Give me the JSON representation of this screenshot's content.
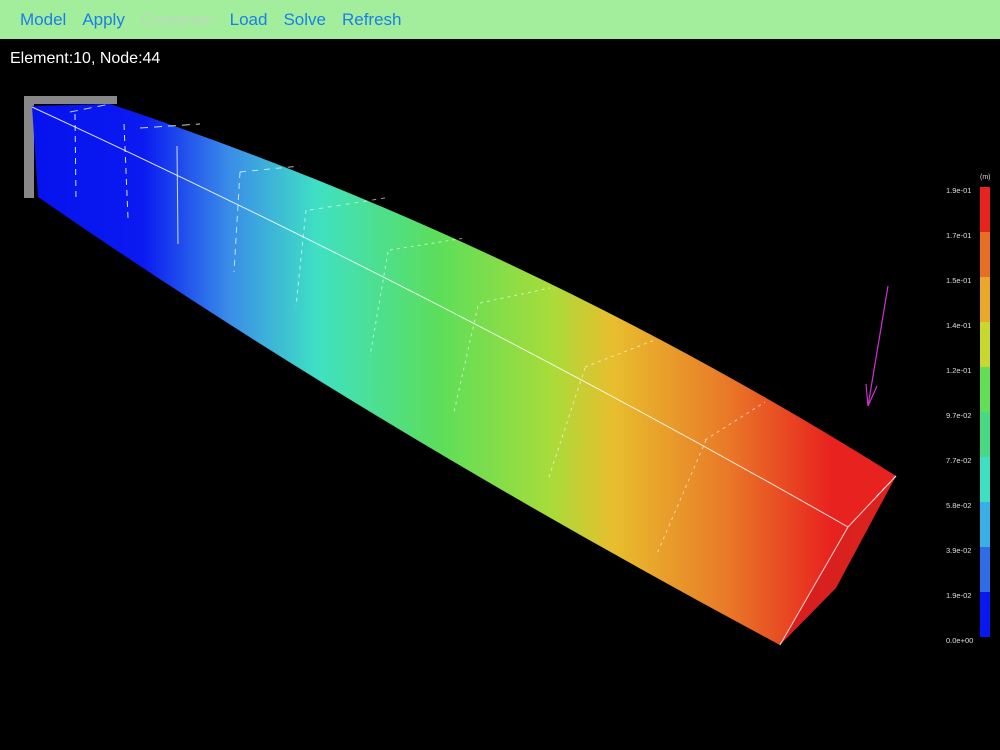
{
  "toolbar": {
    "items": [
      {
        "label": "Model",
        "enabled": true
      },
      {
        "label": "Apply",
        "enabled": true
      },
      {
        "label": "Constrain",
        "enabled": false
      },
      {
        "label": "Load",
        "enabled": true
      },
      {
        "label": "Solve",
        "enabled": true
      },
      {
        "label": "Refresh",
        "enabled": true
      }
    ],
    "colors": {
      "background": "#a3ee9c",
      "enabled": "#1a7fe6",
      "disabled": "#bcd8bd"
    }
  },
  "status": {
    "text": "Element:10, Node:44"
  },
  "legend": {
    "unit": "(m)",
    "ticks": [
      "1.9e-01",
      "1.7e-01",
      "1.5e-01",
      "1.4e-01",
      "1.2e-01",
      "9.7e-02",
      "7.7e-02",
      "5.8e-02",
      "3.9e-02",
      "1.9e-02",
      "0.0e+00"
    ],
    "colors": [
      "#e8231f",
      "#e66e25",
      "#e9a82c",
      "#c8d82e",
      "#63de56",
      "#47d983",
      "#3fdfc4",
      "#3aaee6",
      "#2e6de6",
      "#0a18f0"
    ]
  },
  "viewport": {
    "background": "#000000",
    "load_arrow_color": "#cc33cc",
    "support_color": "#888888"
  }
}
